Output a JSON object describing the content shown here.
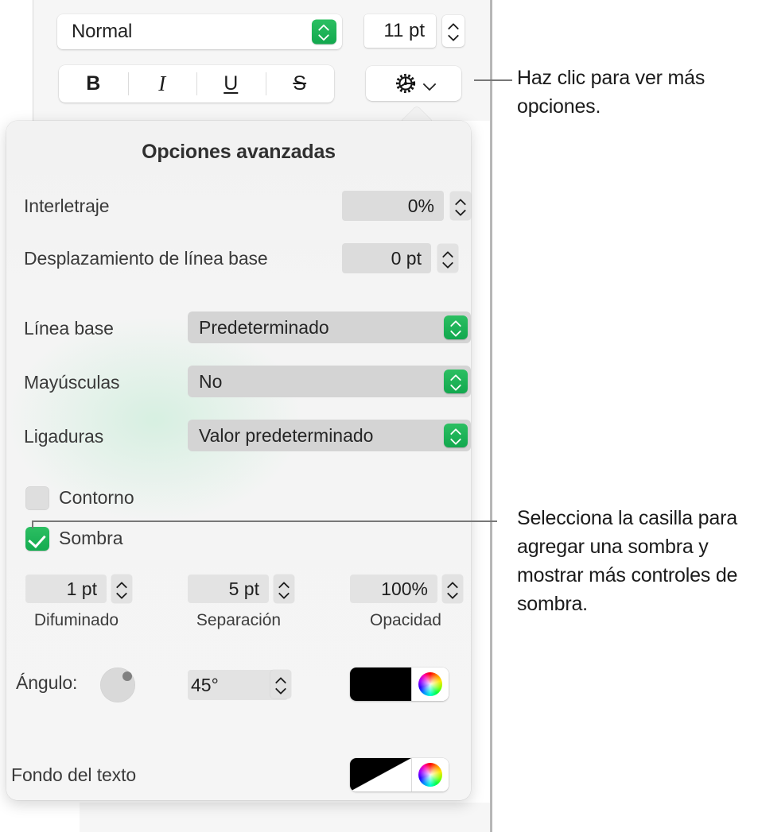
{
  "toolbar": {
    "paragraph_style": "Normal",
    "paragraph_style_icon": "stepper-updown-icon",
    "font_size": "11 pt",
    "font_size_stepper_icon": "stepper-updown-icon",
    "bold_label": "B",
    "italic_label": "I",
    "underline_label": "U",
    "strikethrough_label": "S",
    "gear_icon": "gear-icon",
    "gear_chevron_icon": "chevron-down-icon"
  },
  "popover": {
    "title": "Opciones avanzadas",
    "rows": [
      {
        "label": "Interletraje",
        "value": "0%",
        "stepper_icon": "stepper-updown-icon"
      },
      {
        "label": "Desplazamiento de línea base",
        "value": "0 pt",
        "stepper_icon": "stepper-updown-icon"
      }
    ],
    "selects": [
      {
        "label": "Línea base",
        "value": "Predeterminado",
        "stepper_icon": "stepper-updown-icon"
      },
      {
        "label": "Mayúsculas",
        "value": "No",
        "stepper_icon": "stepper-updown-icon"
      },
      {
        "label": "Ligaduras",
        "value": "Valor predeterminado",
        "stepper_icon": "stepper-updown-icon"
      }
    ],
    "checkboxes": [
      {
        "label": "Contorno",
        "checked": false,
        "icon": "checkbox-unchecked-icon"
      },
      {
        "label": "Sombra",
        "checked": true,
        "icon": "checkbox-checked-icon"
      }
    ],
    "shadow_controls": [
      {
        "value": "1 pt",
        "label": "Difuminado",
        "stepper_icon": "stepper-updown-icon"
      },
      {
        "value": "5 pt",
        "label": "Separación",
        "stepper_icon": "stepper-updown-icon"
      },
      {
        "value": "100%",
        "label": "Opacidad",
        "stepper_icon": "stepper-updown-icon"
      }
    ],
    "angle": {
      "label": "Ángulo:",
      "dial_icon": "angle-dial-icon",
      "value": "45°",
      "stepper_icon": "stepper-updown-icon",
      "color_swatch": "#000000",
      "color_wheel_icon": "color-wheel-icon"
    },
    "text_background": {
      "label": "Fondo del texto",
      "color_swatch": "none-diagonal",
      "color_wheel_icon": "color-wheel-icon"
    }
  },
  "callouts": [
    {
      "text": "Haz clic para ver más opciones."
    },
    {
      "text": "Selecciona la casilla para agregar una sombra y mostrar más controles de sombra."
    }
  ],
  "colors": {
    "accent_green": "#16a34a",
    "popover_tint": "#cdeedb",
    "callout_line": "#777777"
  }
}
